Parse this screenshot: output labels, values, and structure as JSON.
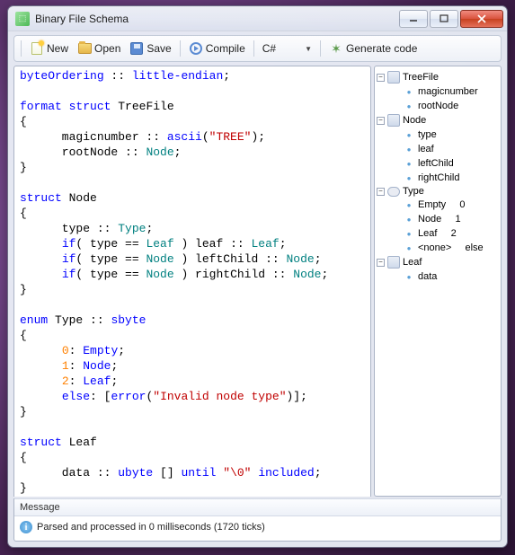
{
  "window": {
    "title": "Binary File Schema"
  },
  "toolbar": {
    "new_label": "New",
    "open_label": "Open",
    "save_label": "Save",
    "compile_label": "Compile",
    "language": "C#",
    "generate_label": "Generate code"
  },
  "code": {
    "l1a": "byteOrdering",
    "l1b": " :: ",
    "l1c": "little-endian",
    "l1d": ";",
    "l3a": "format",
    "l3b": " ",
    "l3c": "struct",
    "l3d": " TreeFile",
    "l4": "{",
    "l5a": "      magicnumber :: ",
    "l5b": "ascii",
    "l5c": "(",
    "l5d": "\"TREE\"",
    "l5e": ");",
    "l6a": "      rootNode :: ",
    "l6b": "Node",
    "l6c": ";",
    "l7": "}",
    "l9a": "struct",
    "l9b": " Node",
    "l10": "{",
    "l11a": "      type :: ",
    "l11b": "Type",
    "l11c": ";",
    "l12a": "      ",
    "l12b": "if",
    "l12c": "( type == ",
    "l12d": "Leaf",
    "l12e": " ) leaf :: ",
    "l12f": "Leaf",
    "l12g": ";",
    "l13a": "      ",
    "l13b": "if",
    "l13c": "( type == ",
    "l13d": "Node",
    "l13e": " ) leftChild :: ",
    "l13f": "Node",
    "l13g": ";",
    "l14a": "      ",
    "l14b": "if",
    "l14c": "( type == ",
    "l14d": "Node",
    "l14e": " ) rightChild :: ",
    "l14f": "Node",
    "l14g": ";",
    "l15": "}",
    "l17a": "enum",
    "l17b": " Type :: ",
    "l17c": "sbyte",
    "l18": "{",
    "l19a": "      ",
    "l19b": "0",
    "l19c": ": ",
    "l19d": "Empty",
    "l19e": ";",
    "l20a": "      ",
    "l20b": "1",
    "l20c": ": ",
    "l20d": "Node",
    "l20e": ";",
    "l21a": "      ",
    "l21b": "2",
    "l21c": ": ",
    "l21d": "Leaf",
    "l21e": ";",
    "l22a": "      ",
    "l22b": "else",
    "l22c": ": [",
    "l22d": "error",
    "l22e": "(",
    "l22f": "\"Invalid node type\"",
    "l22g": ")];",
    "l23": "}",
    "l25a": "struct",
    "l25b": " Leaf",
    "l26": "{",
    "l27a": "      data :: ",
    "l27b": "ubyte",
    "l27c": " [] ",
    "l27d": "until",
    "l27e": " ",
    "l27f": "\"\\0\"",
    "l27g": " ",
    "l27h": "included",
    "l27i": ";",
    "l28": "}"
  },
  "tree": {
    "n0": "TreeFile",
    "n0_0": "magicnumber",
    "n0_1": "rootNode",
    "n1": "Node",
    "n1_0": "type",
    "n1_1": "leaf",
    "n1_2": "leftChild",
    "n1_3": "rightChild",
    "n2": "Type",
    "n2_0": "Empty",
    "n2_0v": "0",
    "n2_1": "Node",
    "n2_1v": "1",
    "n2_2": "Leaf",
    "n2_2v": "2",
    "n2_3": "<none>",
    "n2_3v": "else",
    "n3": "Leaf",
    "n3_0": "data"
  },
  "status": {
    "header": "Message",
    "body": "Parsed and processed in 0 milliseconds (1720 ticks)"
  }
}
